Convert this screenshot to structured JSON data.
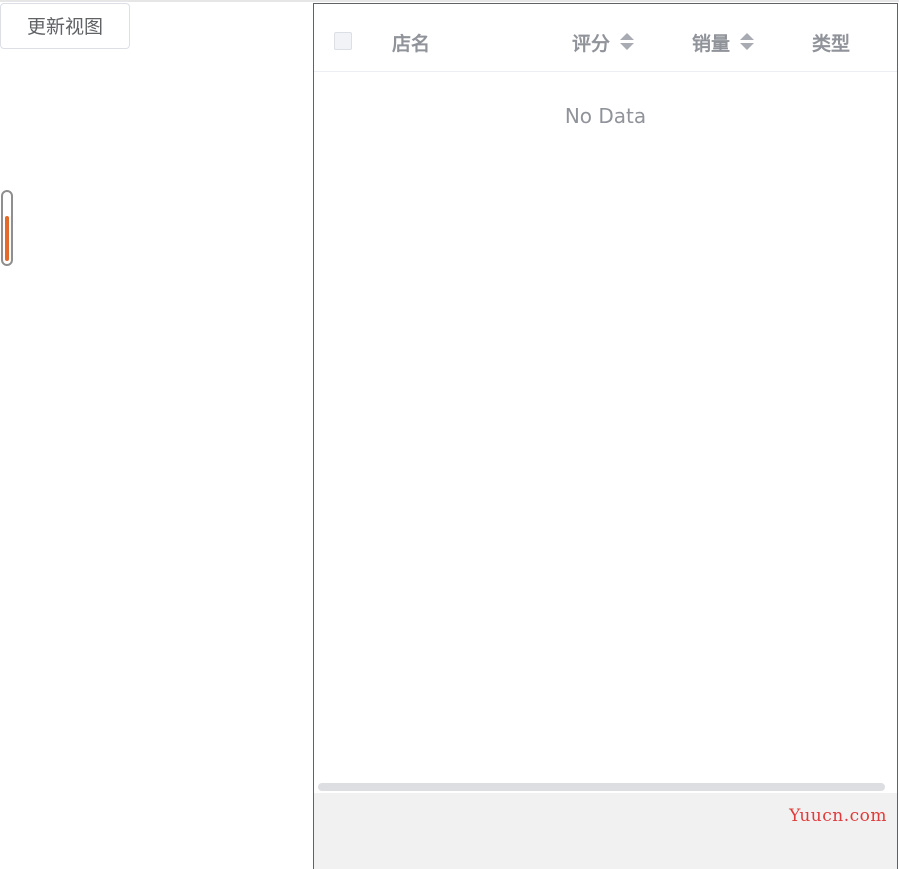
{
  "toolbar": {
    "refresh_label": "更新视图"
  },
  "slider": {
    "level_fraction": 0.68,
    "fill_color": "#e46a2c"
  },
  "table": {
    "columns": [
      {
        "label": "店名",
        "sortable": false
      },
      {
        "label": "评分",
        "sortable": true
      },
      {
        "label": "销量",
        "sortable": true
      },
      {
        "label": "类型",
        "sortable": false
      }
    ],
    "empty_text": "No Data"
  },
  "watermark": "Yuucn.com",
  "colors": {
    "header_text": "#909399",
    "watermark": "#e03a3a",
    "footer_bg": "#f1f1f1"
  }
}
